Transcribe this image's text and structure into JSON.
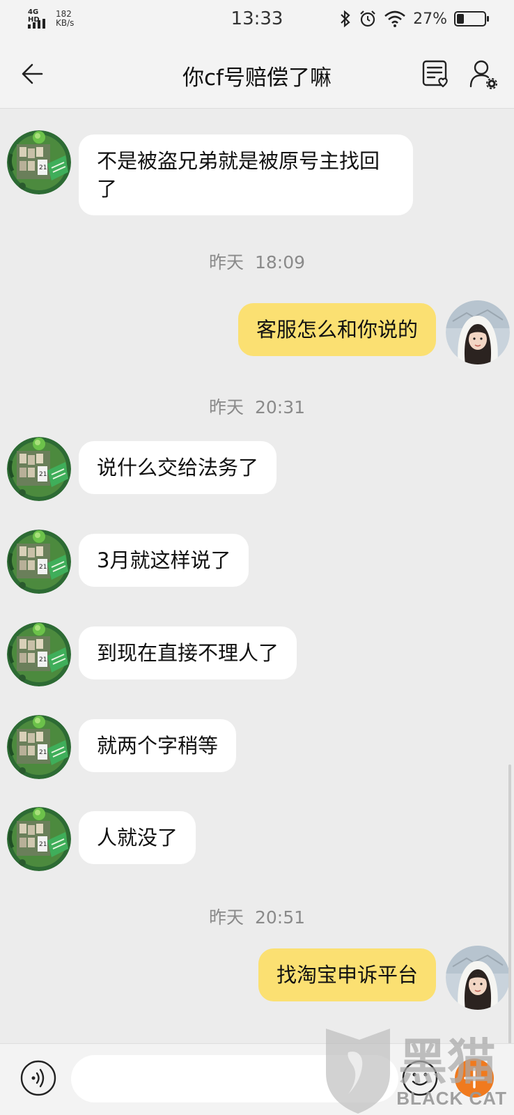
{
  "status_bar": {
    "network": "4G HD",
    "speed_value": "182",
    "speed_unit": "KB/s",
    "time": "13:33",
    "battery_percent": "27%",
    "battery_level": 0.27
  },
  "header": {
    "title": "你cf号赔偿了嘛"
  },
  "messages": [
    {
      "from": "other",
      "text": "不是被盗兄弟就是被原号主找回了"
    },
    {
      "type": "time",
      "day": "昨天",
      "time": "18:09"
    },
    {
      "from": "me",
      "text": "客服怎么和你说的"
    },
    {
      "type": "time",
      "day": "昨天",
      "time": "20:31"
    },
    {
      "from": "other",
      "text": "说什么交给法务了"
    },
    {
      "from": "other",
      "text": "3月就这样说了"
    },
    {
      "from": "other",
      "text": "到现在直接不理人了"
    },
    {
      "from": "other",
      "text": "就两个字稍等"
    },
    {
      "from": "other",
      "text": "人就没了"
    },
    {
      "type": "time",
      "day": "昨天",
      "time": "20:51"
    },
    {
      "from": "me",
      "text": "找淘宝申诉平台"
    }
  ],
  "input": {
    "placeholder": ""
  },
  "watermark": {
    "text": "BLACK CAT",
    "logo_text": "黑猫"
  },
  "colors": {
    "background": "#ececec",
    "my_bubble": "#fbe072",
    "other_bubble": "#ffffff"
  }
}
